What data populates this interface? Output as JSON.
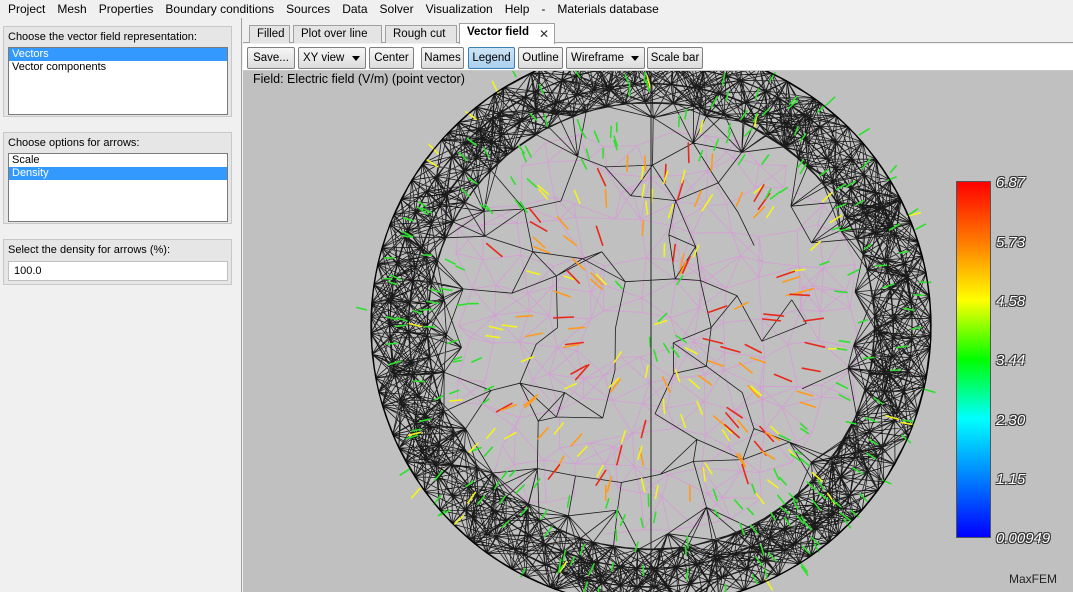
{
  "menu": [
    "Project",
    "Mesh",
    "Properties",
    "Boundary conditions",
    "Sources",
    "Data",
    "Solver",
    "Visualization",
    "Help",
    "-",
    "Materials database"
  ],
  "left_panel": {
    "representation": {
      "label": "Choose the vector field representation:",
      "options": [
        "Vectors",
        "Vector components"
      ],
      "selected": "Vectors"
    },
    "arrows": {
      "label": "Choose options for arrows:",
      "options": [
        "Scale",
        "Density"
      ],
      "selected": "Density"
    },
    "density": {
      "label": "Select the density for arrows (%):",
      "value": "100.0"
    }
  },
  "tabs": [
    {
      "label": "Filled"
    },
    {
      "label": "Plot over line"
    },
    {
      "label": "Rough cut"
    },
    {
      "label": "Vector field",
      "active": true,
      "close": "✕"
    }
  ],
  "toolbar": {
    "save": "Save...",
    "view": "XY view",
    "center": "Center",
    "names": "Names",
    "legend": "Legend",
    "outline": "Outline",
    "wireframe": "Wireframe",
    "scalebar": "Scale bar"
  },
  "viewport": {
    "field_label": "Field: Electric field (V/m) (point vector)",
    "brand": "MaxFEM",
    "legend_ticks": [
      "6.87",
      "5.73",
      "4.58",
      "3.44",
      "2.30",
      "1.15",
      "0.00949"
    ],
    "colors": {
      "background": "#c0c0c0",
      "mesh_outer": "#1a1a1a",
      "mesh_inner": "#d79ad7",
      "selection": "#3399ff"
    }
  }
}
